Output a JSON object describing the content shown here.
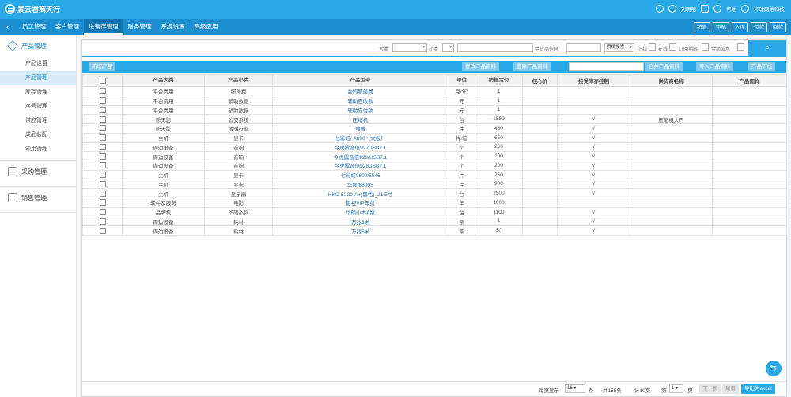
{
  "app": {
    "title": "景云君商天行",
    "user": "刘明明",
    "help": "帮助",
    "company": "环球网络科技"
  },
  "nav": {
    "tabs": [
      "员工管理",
      "客户管理",
      "进销存管理",
      "财务管理",
      "系统设置",
      "高级应用"
    ],
    "active": 2,
    "actions": [
      "销售",
      "审核",
      "入库",
      "付款",
      "回款"
    ]
  },
  "sidebar": {
    "sections": [
      {
        "label": "产品管理",
        "items": [
          "产品设置",
          "产品管理",
          "库存管理",
          "序号管理",
          "供应管理",
          "成品装配",
          "领用管理"
        ]
      },
      {
        "label": "采购管理",
        "items": []
      },
      {
        "label": "销售管理",
        "items": []
      }
    ],
    "active_item": "产品管理"
  },
  "filter": {
    "category_label": "大类",
    "subcategory_label": "小类",
    "supplier_label": "供货商信息",
    "fuzzy_select": "模糊搜索",
    "check_labels": [
      "下线",
      "在线",
      "订阅期限",
      "金额或水"
    ],
    "search_icon": "search-icon"
  },
  "toolbar": {
    "add": "新增产品",
    "modify": "修改产品资料",
    "delete": "删除产品资料",
    "merge": "合并产品资料",
    "import": "导入产品资料",
    "offline": "产品下线"
  },
  "table": {
    "headers": [
      "产品大类",
      "产品小类",
      "产品型号",
      "单位",
      "销售定价",
      "核心价",
      "接受库存控制",
      "供货商名称",
      "产品图样"
    ],
    "rows": [
      [
        "平台费用",
        "服务费",
        "合同服务费",
        "月/年/",
        "1",
        "",
        "",
        "",
        ""
      ],
      [
        "平台费用",
        "辅助数据",
        "辅助应收款",
        "元",
        "1",
        "",
        "",
        "",
        ""
      ],
      [
        "平台费用",
        "辅助数据",
        "辅助应付款",
        "元",
        "1",
        "",
        "",
        "",
        ""
      ],
      [
        "新无影",
        "公交系统",
        "压缩机",
        "台",
        "1550",
        "",
        "√",
        "压缩机大户",
        ""
      ],
      [
        "新无影",
        "地暖行业",
        "地暖",
        "件",
        "480",
        "",
        "√",
        "",
        ""
      ],
      [
        "主机",
        "显卡",
        "七彩虹/ A890（大板）",
        "片/箱",
        "650",
        "",
        "√",
        "",
        ""
      ],
      [
        "周边设备",
        "音响",
        "今虎震音倍927USB7.1",
        "个",
        "260",
        "",
        "√",
        "",
        ""
      ],
      [
        "周边设备",
        "音响",
        "今虎震音倍929/USB7.1",
        "个",
        "100",
        "",
        "√",
        "",
        ""
      ],
      [
        "周边设备",
        "音响",
        "今虎震音倍928USB7.1",
        "个",
        "200",
        "",
        "√",
        "",
        ""
      ],
      [
        "主机",
        "显卡",
        "七彩虹9600/5546",
        "片",
        "750",
        "",
        "√",
        "",
        ""
      ],
      [
        "主机",
        "显卡",
        "华硕/8800S",
        "片",
        "900",
        "",
        "√",
        "",
        ""
      ],
      [
        "主机",
        "显示器",
        "HKC-S220-A+(黑色)_21.5寸",
        "台",
        "2500",
        "",
        "√",
        "",
        ""
      ],
      [
        "软件及服务",
        "电影",
        "影视VIP年费",
        "年",
        "1000",
        "",
        "",
        "",
        ""
      ],
      [
        "品牌机",
        "华硕系列",
        "华硕小本A数",
        "台",
        "1100",
        "",
        "√",
        "",
        ""
      ],
      [
        "周边设备",
        "耗材",
        "万兆3米",
        "条",
        "1",
        "",
        "√",
        "",
        ""
      ],
      [
        "周边设备",
        "耗材",
        "万兆5米",
        "条",
        "50",
        "",
        "√",
        "",
        ""
      ]
    ]
  },
  "pager": {
    "per_page_label": "每页显示",
    "per_page": "16",
    "unit": "条",
    "total": "共155条",
    "pages": "计10页",
    "page_label": "第",
    "page": "1",
    "page_unit": "页",
    "prev": "下一页",
    "last": "尾页",
    "export": "导出为excel"
  }
}
